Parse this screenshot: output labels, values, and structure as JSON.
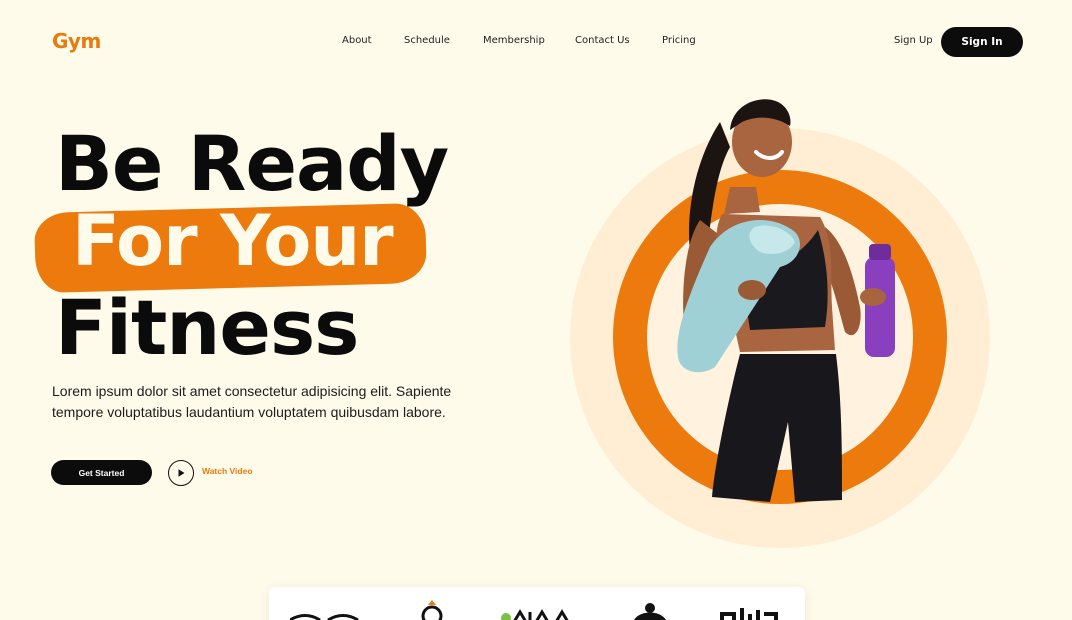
{
  "nav": {
    "logo": "Gym",
    "links": [
      "About",
      "Schedule",
      "Membership",
      "Contact Us",
      "Pricing"
    ],
    "signup": "Sign Up",
    "signin": "Sign In"
  },
  "hero": {
    "line1": "Be Ready",
    "line2": "For Your",
    "line3": "Fitness",
    "description": "Lorem ipsum dolor sit amet consectetur adipisicing elit. Sapiente tempore voluptatibus laudantium voluptatem quibusdam labore.",
    "cta_primary": "Get Started",
    "cta_secondary": "Watch Video"
  },
  "brands": {
    "logos": [
      "brand-logo-1",
      "brand-logo-2",
      "brand-logo-3",
      "brand-logo-4",
      "brand-logo-5"
    ]
  },
  "colors": {
    "accent": "#ec7a0c",
    "background": "#fffbea",
    "dark": "#0c0c0c"
  }
}
